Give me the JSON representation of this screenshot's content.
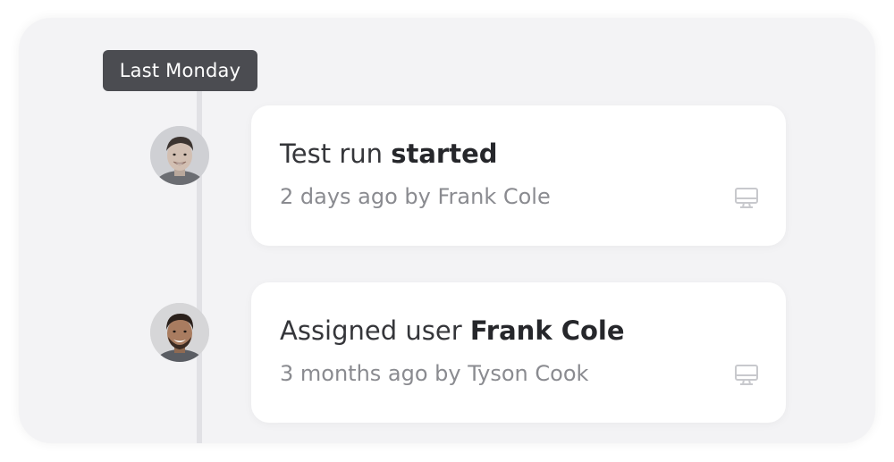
{
  "timeline": {
    "date_label": "Last Monday",
    "events": [
      {
        "title_prefix": "Test run ",
        "title_emphasis": "started",
        "subtitle": "2 days ago by Frank Cole",
        "avatar_alt": "Frank Cole",
        "icon": "desktop-icon"
      },
      {
        "title_prefix": "Assigned user ",
        "title_emphasis": "Frank Cole",
        "subtitle": "3 months ago by Tyson Cook",
        "avatar_alt": "Tyson Cook",
        "icon": "desktop-icon"
      }
    ]
  },
  "colors": {
    "panel_bg": "#f3f3f5",
    "badge_bg": "#4b4c51",
    "timeline_line": "#e1e1e5",
    "card_bg": "#ffffff",
    "title_text": "#35363a",
    "subtitle_text": "#8a8b90",
    "icon_color": "#c8c9cd"
  }
}
